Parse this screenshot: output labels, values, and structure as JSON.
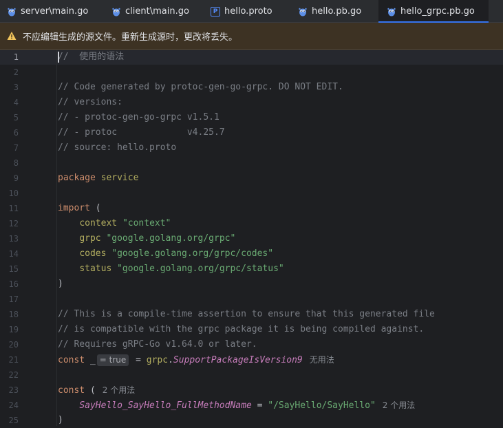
{
  "tabs": [
    {
      "label": "server\\main.go",
      "icon": "gopher-icon"
    },
    {
      "label": "client\\main.go",
      "icon": "gopher-icon"
    },
    {
      "label": "hello.proto",
      "icon": "proto-file-icon",
      "icon_glyph": "P"
    },
    {
      "label": "hello.pb.go",
      "icon": "gopher-icon"
    },
    {
      "label": "hello_grpc.pb.go",
      "icon": "gopher-icon",
      "active": true
    }
  ],
  "banner": {
    "icon": "warning-icon",
    "text": "不应编辑生成的源文件。重新生成源时，更改将丢失。"
  },
  "editor": {
    "current_line": 1,
    "line_numbers": [
      "1",
      "2",
      "3",
      "4",
      "5",
      "6",
      "7",
      "8",
      "9",
      "10",
      "11",
      "12",
      "13",
      "14",
      "15",
      "16",
      "17",
      "18",
      "19",
      "20",
      "21",
      "22",
      "23",
      "24",
      "25"
    ],
    "lines": {
      "l1": "//  使用的语法",
      "l3": "// Code generated by protoc-gen-go-grpc. DO NOT EDIT.",
      "l4": "// versions:",
      "l5": "// - protoc-gen-go-grpc v1.5.1",
      "l6": "// - protoc             v4.25.7",
      "l7": "// source: hello.proto",
      "l9_kw": "package",
      "l9_name": "service",
      "l11_kw": "import",
      "l11_paren": "(",
      "imports": [
        {
          "alias": "context",
          "path": "\"context\""
        },
        {
          "alias": "grpc",
          "path": "\"google.golang.org/grpc\""
        },
        {
          "alias": "codes",
          "path": "\"google.golang.org/grpc/codes\""
        },
        {
          "alias": "status",
          "path": "\"google.golang.org/grpc/status\""
        }
      ],
      "l16": ")",
      "l18": "// This is a compile-time assertion to ensure that this generated file",
      "l19": "// is compatible with the grpc package it is being compiled against.",
      "l20": "// Requires gRPC-Go v1.64.0 or later.",
      "l21_kw": "const",
      "l21_blank": "_",
      "l21_hint": "= true",
      "l21_eq": "=",
      "l21_pkg": "grpc",
      "l21_dot": ".",
      "l21_fn": "SupportPackageIsVersion9",
      "l21_usage": "无用法",
      "l23_kw": "const",
      "l23_paren": "(",
      "l23_usage": "2 个用法",
      "l24_name": "SayHello_SayHello_FullMethodName",
      "l24_eq": "=",
      "l24_val": "\"/SayHello/SayHello\"",
      "l24_usage": "2 个用法",
      "l25": ")"
    }
  }
}
